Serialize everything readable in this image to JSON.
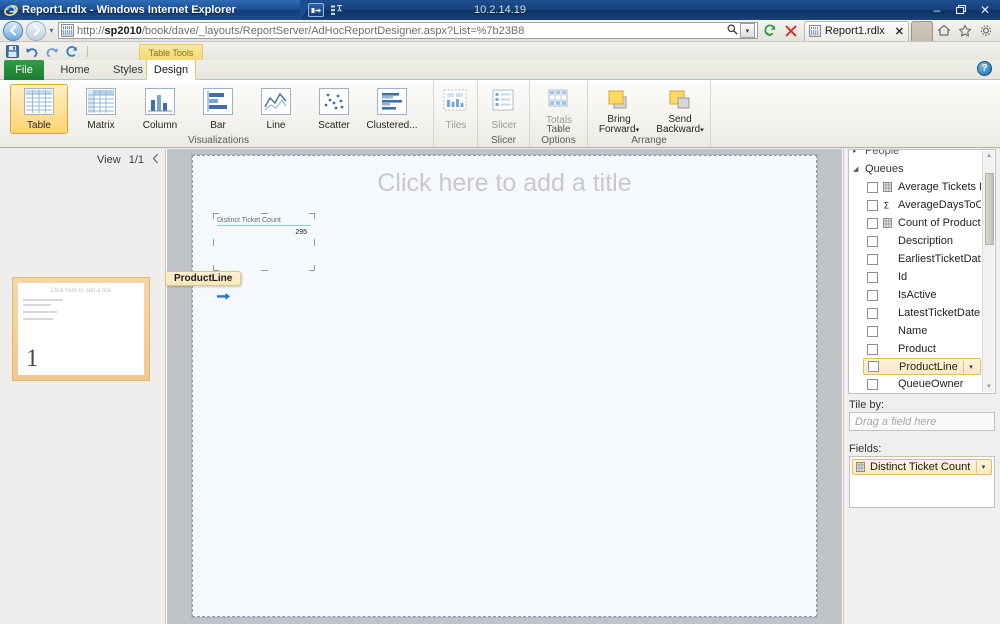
{
  "rdp": {
    "address": "10.2.14.19",
    "pin_icon": "pin-icon",
    "menu_icon": "connection-menu-icon",
    "minimize_label": "–",
    "restore_label": "❐",
    "close_label": "✕"
  },
  "browser": {
    "title": "Report1.rdlx - Windows Internet Explorer",
    "app_icon": "internet-explorer-icon",
    "back_label": "←",
    "forward_label": "→",
    "history_label": "▾",
    "url_display_pre": "http://",
    "url_display_host": "sp2010",
    "url_display_post": "/book/dave/_layouts/ReportServer/AdHocReportDesigner.aspx?List=%7b23B8",
    "url_full": "http://sp2010/book/dave/_layouts/ReportServer/AdHocReportDesigner.aspx?List=%7b23B8",
    "search_icon": "search-icon",
    "dropdown_label": "▾",
    "refresh_label": "↻",
    "stop_label": "✕",
    "tab_label": "Report1.rdlx",
    "tab_close_label": "✕",
    "home_icon": "home-icon",
    "favorites_icon": "star-icon",
    "tools_icon": "gear-icon"
  },
  "qat": {
    "save": "save-icon",
    "undo": "undo-icon",
    "redo": "redo-icon",
    "refresh": "refresh-icon"
  },
  "ribbon": {
    "context_title": "Table Tools",
    "tabs": [
      {
        "label": "File"
      },
      {
        "label": "Home"
      },
      {
        "label": "Styles"
      },
      {
        "label": "Design"
      }
    ],
    "help_label": "?",
    "scroll_up": "▲",
    "scroll_down": "▼",
    "scroll_more": "≡",
    "groups": [
      {
        "label": "Visualizations"
      },
      {
        "label": "Slicer"
      },
      {
        "label": "Table Options"
      },
      {
        "label": "Arrange"
      }
    ],
    "visualizations": [
      {
        "label": "Table",
        "icon": "table-icon",
        "selected": true
      },
      {
        "label": "Matrix",
        "icon": "matrix-icon",
        "selected": false
      },
      {
        "label": "Column",
        "icon": "column-chart-icon",
        "selected": false
      },
      {
        "label": "Bar",
        "icon": "bar-chart-icon",
        "selected": false
      },
      {
        "label": "Line",
        "icon": "line-chart-icon",
        "selected": false
      },
      {
        "label": "Scatter",
        "icon": "scatter-chart-icon",
        "selected": false
      },
      {
        "label": "Clustered...",
        "icon": "clustered-bar-icon",
        "selected": false
      }
    ],
    "tiles_label": "Tiles",
    "slicer_label": "Slicer",
    "totals_label": "Totals",
    "bring_forward_label": "Bring\nForward",
    "bring_forward_line1": "Bring",
    "bring_forward_line2": "Forward",
    "send_backward_line1": "Send",
    "send_backward_line2": "Backward",
    "dropdown_caret": "▾"
  },
  "view_pane": {
    "label": "View",
    "counter": "1/1",
    "collapse_icon": "chevron-left-icon",
    "thumbnail": {
      "title": "Click here to add a title",
      "page_number": "1"
    }
  },
  "canvas": {
    "title_placeholder": "Click here to add a title",
    "table": {
      "header": "Distinct Ticket Count",
      "value": "295"
    },
    "drag_tooltip": "ProductLine",
    "drag_arrow": "➡"
  },
  "field_pane": {
    "groups": [
      {
        "label": "People",
        "expanded": false,
        "caret": "▸"
      },
      {
        "label": "Queues",
        "expanded": true,
        "caret": "◢"
      }
    ],
    "fields": [
      {
        "label": "Average Tickets Per Pr",
        "icon": "measure-grid-icon",
        "checked": false,
        "selected": false,
        "truncated": true
      },
      {
        "label": "AverageDaysToClosur",
        "icon": "sigma-icon",
        "checked": false,
        "selected": false,
        "truncated": true
      },
      {
        "label": "Count of Product",
        "icon": "measure-grid-icon",
        "checked": false,
        "selected": false,
        "truncated": false
      },
      {
        "label": "Description",
        "icon": "",
        "checked": false,
        "selected": false,
        "truncated": false
      },
      {
        "label": "EarliestTicketDate",
        "icon": "",
        "checked": false,
        "selected": false,
        "truncated": false
      },
      {
        "label": "Id",
        "icon": "",
        "checked": false,
        "selected": false,
        "truncated": false
      },
      {
        "label": "IsActive",
        "icon": "",
        "checked": false,
        "selected": false,
        "truncated": false
      },
      {
        "label": "LatestTicketDate",
        "icon": "",
        "checked": false,
        "selected": false,
        "truncated": false
      },
      {
        "label": "Name",
        "icon": "",
        "checked": false,
        "selected": false,
        "truncated": false
      },
      {
        "label": "Product",
        "icon": "",
        "checked": false,
        "selected": false,
        "truncated": false
      },
      {
        "label": "ProductLine",
        "icon": "",
        "checked": false,
        "selected": true,
        "truncated": false
      },
      {
        "label": "QueueOwner",
        "icon": "",
        "checked": false,
        "selected": false,
        "truncated": false
      }
    ],
    "tile_by_label": "Tile by:",
    "tile_by_placeholder": "Drag a field here",
    "fields_label": "Fields:",
    "field_chips": [
      {
        "label": "Distinct Ticket Count",
        "icon": "measure-grid-icon",
        "caret": "▾"
      }
    ],
    "scroll_up": "▲",
    "scroll_down": "▼"
  }
}
